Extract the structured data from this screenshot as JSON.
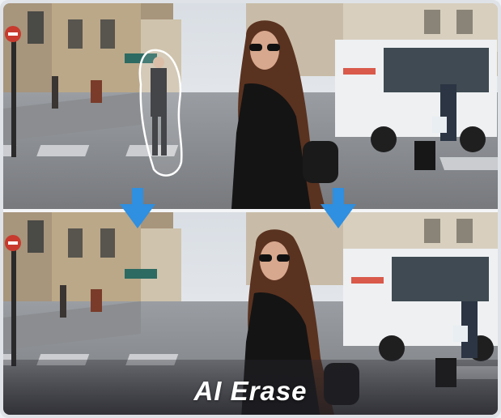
{
  "caption": {
    "text": "AI Erase"
  },
  "colors": {
    "arrow": "#2f8fe0",
    "selection_outline": "#ffffff",
    "caption_text": "#ffffff"
  },
  "icons": {
    "arrow": "arrow-down-icon",
    "selection": "lasso-selection-icon"
  }
}
